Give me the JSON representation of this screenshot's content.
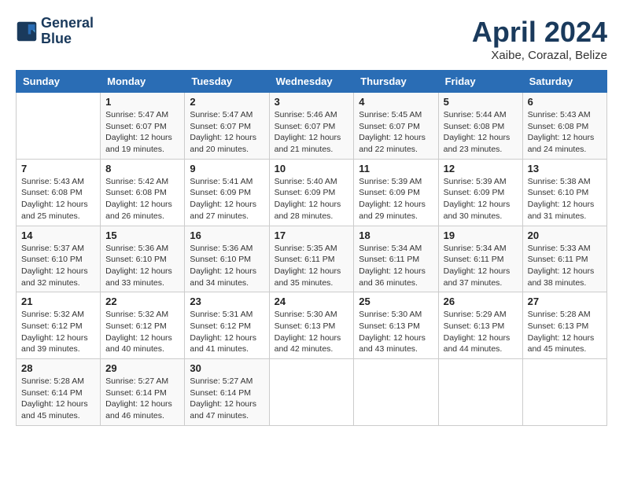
{
  "header": {
    "logo_line1": "General",
    "logo_line2": "Blue",
    "month": "April 2024",
    "location": "Xaibe, Corazal, Belize"
  },
  "columns": [
    "Sunday",
    "Monday",
    "Tuesday",
    "Wednesday",
    "Thursday",
    "Friday",
    "Saturday"
  ],
  "weeks": [
    [
      {
        "num": "",
        "info": ""
      },
      {
        "num": "1",
        "info": "Sunrise: 5:47 AM\nSunset: 6:07 PM\nDaylight: 12 hours\nand 19 minutes."
      },
      {
        "num": "2",
        "info": "Sunrise: 5:47 AM\nSunset: 6:07 PM\nDaylight: 12 hours\nand 20 minutes."
      },
      {
        "num": "3",
        "info": "Sunrise: 5:46 AM\nSunset: 6:07 PM\nDaylight: 12 hours\nand 21 minutes."
      },
      {
        "num": "4",
        "info": "Sunrise: 5:45 AM\nSunset: 6:07 PM\nDaylight: 12 hours\nand 22 minutes."
      },
      {
        "num": "5",
        "info": "Sunrise: 5:44 AM\nSunset: 6:08 PM\nDaylight: 12 hours\nand 23 minutes."
      },
      {
        "num": "6",
        "info": "Sunrise: 5:43 AM\nSunset: 6:08 PM\nDaylight: 12 hours\nand 24 minutes."
      }
    ],
    [
      {
        "num": "7",
        "info": "Sunrise: 5:43 AM\nSunset: 6:08 PM\nDaylight: 12 hours\nand 25 minutes."
      },
      {
        "num": "8",
        "info": "Sunrise: 5:42 AM\nSunset: 6:08 PM\nDaylight: 12 hours\nand 26 minutes."
      },
      {
        "num": "9",
        "info": "Sunrise: 5:41 AM\nSunset: 6:09 PM\nDaylight: 12 hours\nand 27 minutes."
      },
      {
        "num": "10",
        "info": "Sunrise: 5:40 AM\nSunset: 6:09 PM\nDaylight: 12 hours\nand 28 minutes."
      },
      {
        "num": "11",
        "info": "Sunrise: 5:39 AM\nSunset: 6:09 PM\nDaylight: 12 hours\nand 29 minutes."
      },
      {
        "num": "12",
        "info": "Sunrise: 5:39 AM\nSunset: 6:09 PM\nDaylight: 12 hours\nand 30 minutes."
      },
      {
        "num": "13",
        "info": "Sunrise: 5:38 AM\nSunset: 6:10 PM\nDaylight: 12 hours\nand 31 minutes."
      }
    ],
    [
      {
        "num": "14",
        "info": "Sunrise: 5:37 AM\nSunset: 6:10 PM\nDaylight: 12 hours\nand 32 minutes."
      },
      {
        "num": "15",
        "info": "Sunrise: 5:36 AM\nSunset: 6:10 PM\nDaylight: 12 hours\nand 33 minutes."
      },
      {
        "num": "16",
        "info": "Sunrise: 5:36 AM\nSunset: 6:10 PM\nDaylight: 12 hours\nand 34 minutes."
      },
      {
        "num": "17",
        "info": "Sunrise: 5:35 AM\nSunset: 6:11 PM\nDaylight: 12 hours\nand 35 minutes."
      },
      {
        "num": "18",
        "info": "Sunrise: 5:34 AM\nSunset: 6:11 PM\nDaylight: 12 hours\nand 36 minutes."
      },
      {
        "num": "19",
        "info": "Sunrise: 5:34 AM\nSunset: 6:11 PM\nDaylight: 12 hours\nand 37 minutes."
      },
      {
        "num": "20",
        "info": "Sunrise: 5:33 AM\nSunset: 6:11 PM\nDaylight: 12 hours\nand 38 minutes."
      }
    ],
    [
      {
        "num": "21",
        "info": "Sunrise: 5:32 AM\nSunset: 6:12 PM\nDaylight: 12 hours\nand 39 minutes."
      },
      {
        "num": "22",
        "info": "Sunrise: 5:32 AM\nSunset: 6:12 PM\nDaylight: 12 hours\nand 40 minutes."
      },
      {
        "num": "23",
        "info": "Sunrise: 5:31 AM\nSunset: 6:12 PM\nDaylight: 12 hours\nand 41 minutes."
      },
      {
        "num": "24",
        "info": "Sunrise: 5:30 AM\nSunset: 6:13 PM\nDaylight: 12 hours\nand 42 minutes."
      },
      {
        "num": "25",
        "info": "Sunrise: 5:30 AM\nSunset: 6:13 PM\nDaylight: 12 hours\nand 43 minutes."
      },
      {
        "num": "26",
        "info": "Sunrise: 5:29 AM\nSunset: 6:13 PM\nDaylight: 12 hours\nand 44 minutes."
      },
      {
        "num": "27",
        "info": "Sunrise: 5:28 AM\nSunset: 6:13 PM\nDaylight: 12 hours\nand 45 minutes."
      }
    ],
    [
      {
        "num": "28",
        "info": "Sunrise: 5:28 AM\nSunset: 6:14 PM\nDaylight: 12 hours\nand 45 minutes."
      },
      {
        "num": "29",
        "info": "Sunrise: 5:27 AM\nSunset: 6:14 PM\nDaylight: 12 hours\nand 46 minutes."
      },
      {
        "num": "30",
        "info": "Sunrise: 5:27 AM\nSunset: 6:14 PM\nDaylight: 12 hours\nand 47 minutes."
      },
      {
        "num": "",
        "info": ""
      },
      {
        "num": "",
        "info": ""
      },
      {
        "num": "",
        "info": ""
      },
      {
        "num": "",
        "info": ""
      }
    ]
  ]
}
